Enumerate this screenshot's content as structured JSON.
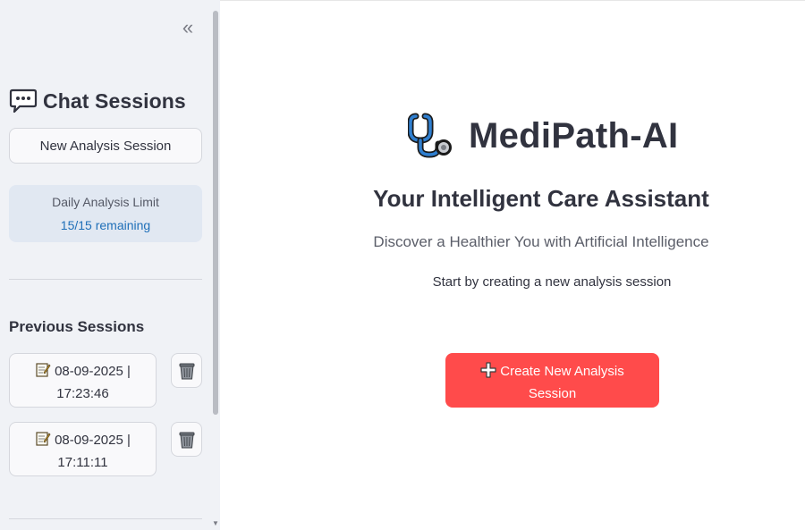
{
  "sidebar": {
    "collapse_glyph": "«",
    "title": "Chat Sessions",
    "title_icon": "speech-balloon-icon",
    "new_session_label": "New Analysis Session",
    "limit": {
      "label": "Daily Analysis Limit",
      "value": "15/15 remaining"
    },
    "previous_title": "Previous Sessions",
    "sessions": [
      {
        "date": "08-09-2025 |",
        "time": "17:23:46",
        "icon": "memo-icon"
      },
      {
        "date": "08-09-2025 |",
        "time": "17:11:11",
        "icon": "memo-icon"
      }
    ],
    "delete_icon": "wastebasket-icon"
  },
  "main": {
    "app_name": "MediPath-AI",
    "logo_icon": "stethoscope-icon",
    "subtitle": "Your Intelligent Care Assistant",
    "tagline": "Discover a Healthier You with Artificial Intelligence",
    "hint": "Start by creating a new analysis session",
    "create_button": {
      "line1": "Create New Analysis",
      "line2": "Session",
      "icon": "plus-icon"
    }
  },
  "colors": {
    "sidebar_bg": "#f0f2f6",
    "primary": "#ff4b4b",
    "info_bg": "#e1e8f2",
    "info_text": "#1f6fb8",
    "text": "#31333f"
  }
}
